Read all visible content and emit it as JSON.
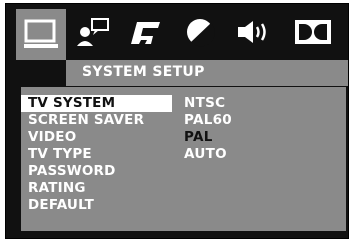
{
  "tabs": [
    {
      "icon": "monitor-icon",
      "active": true
    },
    {
      "icon": "user-message-icon",
      "active": false
    },
    {
      "icon": "music-note-icon",
      "active": false
    },
    {
      "icon": "contrast-icon",
      "active": false
    },
    {
      "icon": "speaker-icon",
      "active": false
    },
    {
      "icon": "dolby-icon",
      "active": false
    }
  ],
  "header": {
    "title": "SYSTEM SETUP"
  },
  "menu": {
    "items": [
      "TV SYSTEM",
      "SCREEN SAVER",
      "VIDEO",
      "TV TYPE",
      "PASSWORD",
      "RATING",
      "DEFAULT"
    ],
    "selected": "TV SYSTEM"
  },
  "options": {
    "items": [
      "NTSC",
      "PAL60",
      "PAL",
      "AUTO"
    ],
    "current": "PAL"
  },
  "colors": {
    "background": "#111111",
    "panel": "#8a8a8a",
    "text": "#ffffff",
    "highlight": "#ffffff"
  }
}
